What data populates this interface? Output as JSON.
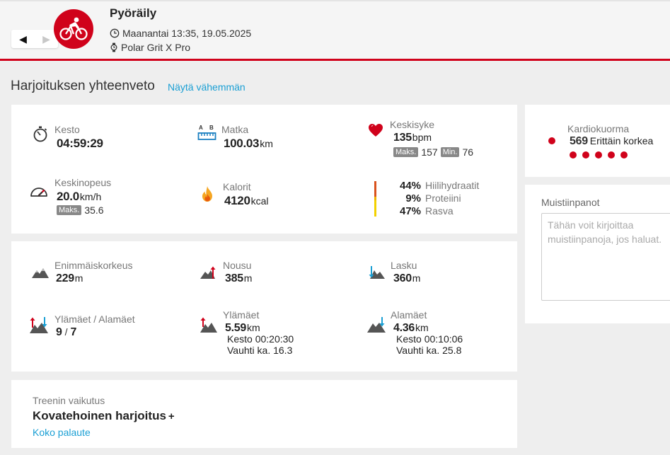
{
  "header": {
    "sport": "Pyöräily",
    "datetime": "Maanantai 13:35, 19.05.2025",
    "device": "Polar Grit X Pro",
    "prev": "◀",
    "next": "▶"
  },
  "summary": {
    "title": "Harjoituksen yhteenveto",
    "toggle": "Näytä vähemmän"
  },
  "stats": {
    "duration": {
      "label": "Kesto",
      "value": "04:59:29"
    },
    "distance": {
      "label": "Matka",
      "value": "100.03",
      "unit": "km",
      "icon_text": "A  B"
    },
    "heart_rate": {
      "label": "Keskisyke",
      "value": "135",
      "unit": "bpm",
      "max_tag": "Maks.",
      "max": "157",
      "min_tag": "Min.",
      "min": "76"
    },
    "speed": {
      "label": "Keskinopeus",
      "value": "20.0",
      "unit": "km/h",
      "max_tag": "Maks.",
      "max": "35.6"
    },
    "calories": {
      "label": "Kalorit",
      "value": "4120",
      "unit": "kcal"
    },
    "macros": [
      {
        "pct": "44%",
        "name": "Hiilihydraatit"
      },
      {
        "pct": "9%",
        "name": "Proteiini"
      },
      {
        "pct": "47%",
        "name": "Rasva"
      }
    ]
  },
  "elevation": {
    "max_alt": {
      "label": "Enimmäiskorkeus",
      "value": "229",
      "unit": "m"
    },
    "ascent": {
      "label": "Nousu",
      "value": "385",
      "unit": "m"
    },
    "descent": {
      "label": "Lasku",
      "value": "360",
      "unit": "m"
    },
    "climbs": {
      "label": "Ylämäet / Alamäet",
      "up": "9",
      "sep": "/",
      "down": "7"
    },
    "uphills": {
      "label": "Ylämäet",
      "value": "5.59",
      "unit": "km",
      "duration": "Kesto 00:20:30",
      "pace": "Vauhti ka. 16.3"
    },
    "downhills": {
      "label": "Alamäet",
      "value": "4.36",
      "unit": "km",
      "duration": "Kesto 00:10:06",
      "pace": "Vauhti ka. 25.8"
    }
  },
  "training_effect": {
    "label": "Treenin vaikutus",
    "value": "Kovatehoinen harjoitus",
    "plus": "+",
    "link": "Koko palaute"
  },
  "cardio": {
    "label": "Kardiokuorma",
    "value": "569",
    "text": "Erittäin korkea",
    "level": 5,
    "max_level": 5
  },
  "notes": {
    "label": "Muistiinpanot",
    "placeholder": "Tähän voit kirjoittaa muistiinpanoja, jos haluat."
  },
  "colors": {
    "accent": "#d0021b",
    "link": "#1a9fd4",
    "background": "#eeeeee",
    "card": "#ffffff"
  }
}
